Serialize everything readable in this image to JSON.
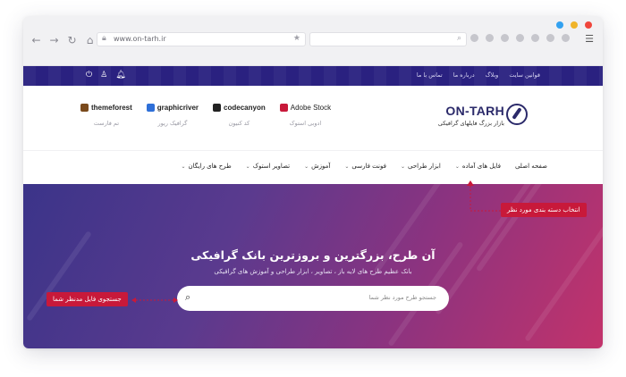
{
  "browser": {
    "url": "www.on-tarh.ir",
    "window_dots": [
      "#33a1f0",
      "#f0b42a",
      "#f0463c"
    ]
  },
  "topbar": {
    "links": [
      "قوانین سایت",
      "وبلاگ",
      "درباره ما",
      "تماس با ما"
    ],
    "icons": [
      "bell-icon",
      "user-icon",
      "power-icon"
    ]
  },
  "header": {
    "logo_name": "ON-TARH",
    "logo_tagline": "بازار بزرگ فایلهای گرافیکی",
    "markets": [
      {
        "brand": "Adobe Stock",
        "sub": "ادوبی استوک",
        "color": "#c8193a"
      },
      {
        "brand": "codecanyon",
        "sub": "کد کنیون",
        "color": "#222222"
      },
      {
        "brand": "graphicriver",
        "sub": "گرافیک ریور",
        "color": "#2e6fd8"
      },
      {
        "brand": "themeforest",
        "sub": "تم فارست",
        "color": "#7a4a1c"
      }
    ]
  },
  "menu": {
    "items": [
      {
        "label": "صفحه اصلی",
        "has_dropdown": false
      },
      {
        "label": "فایل های آماده",
        "has_dropdown": true
      },
      {
        "label": "ابزار طراحی",
        "has_dropdown": true
      },
      {
        "label": "فونت فارسی",
        "has_dropdown": true
      },
      {
        "label": "آموزش",
        "has_dropdown": true
      },
      {
        "label": "تصاویر استوک",
        "has_dropdown": true
      },
      {
        "label": "طرح های رایگان",
        "has_dropdown": true
      }
    ]
  },
  "hero": {
    "title": "آن طرح، بزرگترین و بروزترین بانک گرافیکی",
    "subtitle": "بانک عظیم طرح های لایه باز ، تصاویر ، ابزار طراحی و آموزش های گرافیکی",
    "search_placeholder": "جستجو طرح مورد نظر شما"
  },
  "annotations": {
    "category": "انتخاب دسته بندی مورد نظر",
    "search": "جستجوی فایل مدنظر شما",
    "color": "#c8193a"
  }
}
